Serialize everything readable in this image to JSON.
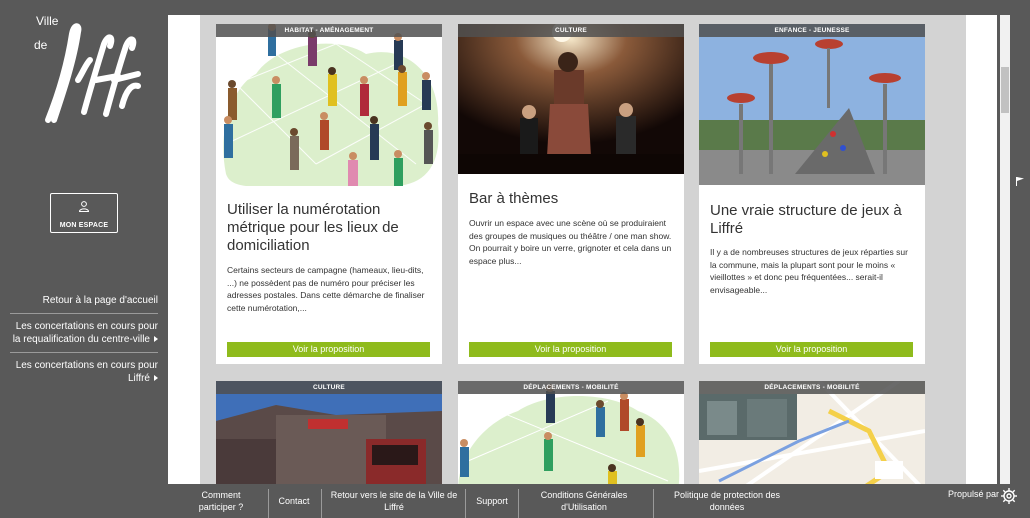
{
  "brand": {
    "ville": "Ville",
    "de": "de",
    "name": "Liffré"
  },
  "sidebar": {
    "espace_label": "MON ESPACE",
    "nav": [
      {
        "label": "Retour à la page d'accueil"
      },
      {
        "label": "Les concertations en cours pour la requalification du centre-ville"
      },
      {
        "label": "Les concertations en cours pour Liffré"
      }
    ]
  },
  "cards": [
    {
      "category": "HABITAT - AMÉNAGEMENT",
      "title": "Utiliser la numérotation métrique pour les lieux de domiciliation",
      "excerpt": "Certains secteurs de campagne (hameaux, lieu-dits, ...) ne possèdent pas de numéro pour préciser les adresses postales. Dans cette démarche de finaliser cette numérotation,...",
      "button": "Voir la proposition"
    },
    {
      "category": "CULTURE",
      "title": "Bar à thèmes",
      "excerpt": "Ouvrir un espace avec une scène où se produiraient des groupes de musiques ou théâtre / one man show. On pourrait y boire un verre, grignoter et cela dans un espace plus...",
      "button": "Voir la proposition"
    },
    {
      "category": "ENFANCE - JEUNESSE",
      "title": "Une vraie structure de jeux à Liffré",
      "excerpt": "Il y a de nombreuses structures de jeux réparties sur la commune, mais la plupart sont pour le moins « vieillottes » et donc peu fréquentées... serait-il envisageable...",
      "button": "Voir la proposition"
    },
    {
      "category": "CULTURE"
    },
    {
      "category": "DÉPLACEMENTS - MOBILITÉ"
    },
    {
      "category": "DÉPLACEMENTS - MOBILITÉ"
    }
  ],
  "footer": {
    "links": [
      {
        "label": "Comment participer ?"
      },
      {
        "label": "Contact"
      },
      {
        "label": "Retour vers le site de la Ville de Liffré"
      },
      {
        "label": "Support"
      },
      {
        "label": "Conditions Générales d'Utilisation"
      },
      {
        "label": "Politique de protection des données"
      }
    ],
    "propulse": "Propulsé par"
  },
  "colors": {
    "accent": "#8fbb1c",
    "sidebar": "#595959",
    "panel": "#d3d3d3"
  }
}
